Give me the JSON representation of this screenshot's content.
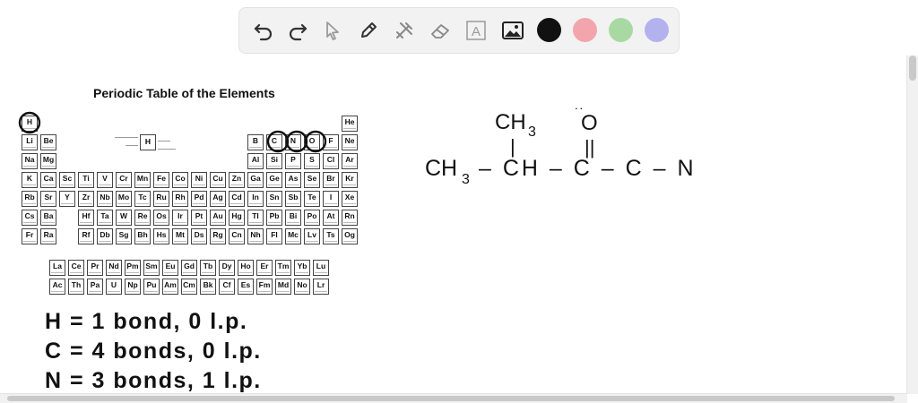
{
  "toolbar": {
    "tools": [
      {
        "icon": "undo-icon"
      },
      {
        "icon": "redo-icon"
      },
      {
        "icon": "select-pointer-icon"
      },
      {
        "icon": "pen-icon"
      },
      {
        "icon": "tools-icon"
      },
      {
        "icon": "eraser-icon"
      },
      {
        "icon": "text-icon",
        "glyph": "A"
      },
      {
        "icon": "image-icon"
      }
    ],
    "colors": [
      "#111111",
      "#f2a5ad",
      "#a9d9a2",
      "#b3b2ee"
    ]
  },
  "periodic_table": {
    "title": "Periodic Table of the Elements",
    "key_symbol": "H",
    "main_rows": [
      [
        "H",
        "",
        "",
        "",
        "",
        "",
        "",
        "",
        "",
        "",
        "",
        "",
        "",
        "",
        "",
        "",
        "",
        "He"
      ],
      [
        "Li",
        "Be",
        "",
        "",
        "",
        "",
        "",
        "",
        "",
        "",
        "",
        "",
        "B",
        "C",
        "N",
        "O",
        "F",
        "Ne"
      ],
      [
        "Na",
        "Mg",
        "",
        "",
        "",
        "",
        "",
        "",
        "",
        "",
        "",
        "",
        "Al",
        "Si",
        "P",
        "S",
        "Cl",
        "Ar"
      ],
      [
        "K",
        "Ca",
        "Sc",
        "Ti",
        "V",
        "Cr",
        "Mn",
        "Fe",
        "Co",
        "Ni",
        "Cu",
        "Zn",
        "Ga",
        "Ge",
        "As",
        "Se",
        "Br",
        "Kr"
      ],
      [
        "Rb",
        "Sr",
        "Y",
        "Zr",
        "Nb",
        "Mo",
        "Tc",
        "Ru",
        "Rh",
        "Pd",
        "Ag",
        "Cd",
        "In",
        "Sn",
        "Sb",
        "Te",
        "I",
        "Xe"
      ],
      [
        "Cs",
        "Ba",
        "",
        "Hf",
        "Ta",
        "W",
        "Re",
        "Os",
        "Ir",
        "Pt",
        "Au",
        "Hg",
        "Tl",
        "Pb",
        "Bi",
        "Po",
        "At",
        "Rn"
      ],
      [
        "Fr",
        "Ra",
        "",
        "Rf",
        "Db",
        "Sg",
        "Bh",
        "Hs",
        "Mt",
        "Ds",
        "Rg",
        "Cn",
        "Nh",
        "Fl",
        "Mc",
        "Lv",
        "Ts",
        "Og"
      ]
    ],
    "f_rows": [
      [
        "La",
        "Ce",
        "Pr",
        "Nd",
        "Pm",
        "Sm",
        "Eu",
        "Gd",
        "Tb",
        "Dy",
        "Ho",
        "Er",
        "Tm",
        "Yb",
        "Lu"
      ],
      [
        "Ac",
        "Th",
        "Pa",
        "U",
        "Np",
        "Pu",
        "Am",
        "Cm",
        "Bk",
        "Cf",
        "Es",
        "Fm",
        "Md",
        "No",
        "Lr"
      ]
    ]
  },
  "handwriting": {
    "structure": {
      "ch3_top": "CH",
      "ch3_top_sub": "3",
      "oxygen_lone_pair": "˙˙",
      "oxygen": "O",
      "single_bond": "|",
      "double_bond": "||",
      "ch3_left": "CH",
      "ch3_left_sub": "3",
      "chain": "– CH – C – C – N"
    },
    "notes": [
      "H = 1 bond, 0 l.p.",
      "C = 4 bonds, 0 l.p.",
      "N = 3 bonds, 1 l.p."
    ]
  }
}
